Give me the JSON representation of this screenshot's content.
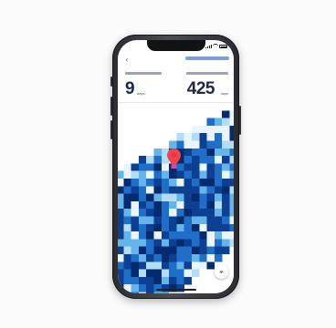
{
  "status_bar": {
    "time": ""
  },
  "header": {
    "left_stat": {
      "caption": "",
      "value": "9",
      "unit": "days"
    },
    "right_stat": {
      "caption": "",
      "value": "425",
      "unit": "days"
    }
  },
  "nav": {
    "back_icon": "chevron-left-icon",
    "action_label": ""
  },
  "map": {
    "pin_icon": "map-pin-icon",
    "locate_icon": "locate-icon",
    "colors": {
      "lightest": "#e9f4fd",
      "light": "#b3dcf7",
      "sky": "#65b4ea",
      "mid": "#1f6fc8",
      "dark": "#0d3f93",
      "darkest": "#062a6e",
      "pin": "#f0434a"
    }
  }
}
